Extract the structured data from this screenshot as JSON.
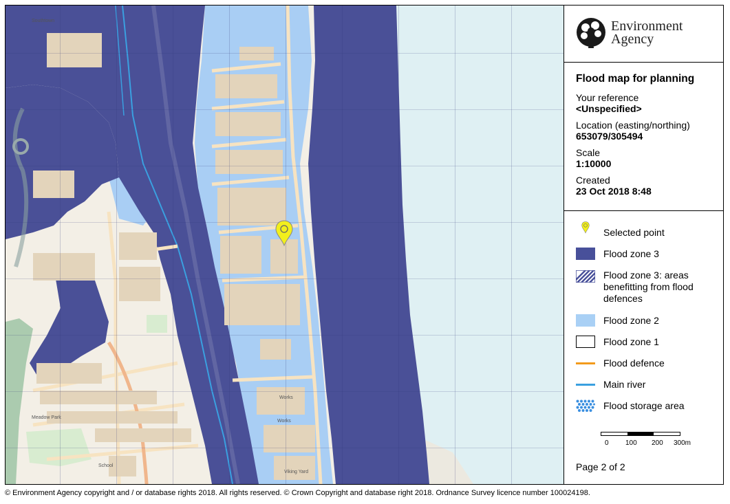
{
  "organisation": {
    "line1": "Environment",
    "line2": "Agency"
  },
  "info": {
    "title": "Flood map for planning",
    "reference_label": "Your reference",
    "reference_value": "<Unspecified>",
    "location_label": "Location (easting/northing)",
    "location_value": "653079/305494",
    "scale_label": "Scale",
    "scale_value": "1:10000",
    "created_label": "Created",
    "created_value": "23 Oct 2018 8:48"
  },
  "legend": [
    {
      "label": "Selected point",
      "icon": "map-pin-icon",
      "color": "#f2ef1c"
    },
    {
      "label": "Flood zone 3",
      "icon": "solid-swatch",
      "color": "#48509a"
    },
    {
      "label": "Flood zone 3: areas benefitting from flood defences",
      "icon": "hatched-swatch",
      "color": "#48509a"
    },
    {
      "label": "Flood zone 2",
      "icon": "solid-swatch",
      "color": "#a9d0f5"
    },
    {
      "label": "Flood zone 1",
      "icon": "outline-swatch",
      "color": "#ffffff"
    },
    {
      "label": "Flood defence",
      "icon": "line-swatch",
      "color": "#f29a1b"
    },
    {
      "label": "Main river",
      "icon": "line-swatch",
      "color": "#3aa0e0"
    },
    {
      "label": "Flood storage area",
      "icon": "dot-swatch",
      "color": "#3a8fe0"
    }
  ],
  "scalebar": {
    "ticks": [
      "0",
      "100",
      "200",
      "300m"
    ]
  },
  "page": "Page 2 of 2",
  "map": {
    "place_labels": [
      "Southtown",
      "Works",
      "Viking Yard",
      "Meadow Park",
      "School",
      "Works"
    ],
    "colors": {
      "sea": "#dff0f3",
      "land": "#f3efe6",
      "zone3": "#4a5097",
      "zone2": "#a9cef4",
      "building": "#e3d4bb",
      "road": "#f7e3c1",
      "pin": "#f2ef1c"
    }
  },
  "copyright": "© Environment Agency copyright and / or database rights 2018. All rights reserved. © Crown Copyright and database right 2018. Ordnance Survey licence number 100024198."
}
